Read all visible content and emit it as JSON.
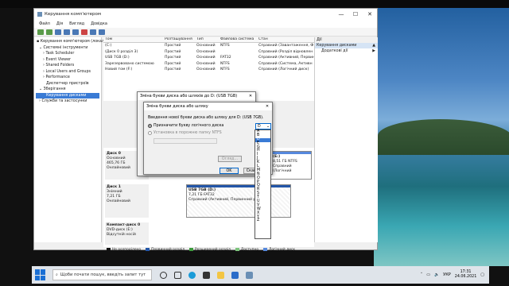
{
  "window": {
    "title": "Керування комп'ютером",
    "minimize": "—",
    "maximize": "☐",
    "close": "✕"
  },
  "menu": [
    "Файл",
    "Дія",
    "Вигляд",
    "Довідка"
  ],
  "tree": [
    {
      "label": "Керування комп'ютером (локальний)",
      "level": 0
    },
    {
      "label": "Системні інструменти",
      "level": 1
    },
    {
      "label": "Task Scheduler",
      "level": 2
    },
    {
      "label": "Event Viewer",
      "level": 2
    },
    {
      "label": "Shared Folders",
      "level": 2
    },
    {
      "label": "Local Users and Groups",
      "level": 2
    },
    {
      "label": "Performance",
      "level": 2
    },
    {
      "label": "Диспетчер пристроїв",
      "level": 2
    },
    {
      "label": "Зберігання",
      "level": 1
    },
    {
      "label": "Керування дисками",
      "level": 2,
      "selected": true
    },
    {
      "label": "Служби та застосунки",
      "level": 1
    }
  ],
  "grid": {
    "columns": [
      "Том",
      "Розташування",
      "Тип",
      "Файлова система",
      "Стан"
    ],
    "rows": [
      [
        "(C:)",
        "Простий",
        "Основний",
        "NTFS",
        "Справний (Завантаження, Ф"
      ],
      [
        "(Диск 0 розділ 3)",
        "Простий",
        "Основний",
        "",
        "Справний (Розділ відновлен"
      ],
      [
        "USB 7GB (D:)",
        "Простий",
        "Основний",
        "FAT32",
        "Справний (Активний, Первин"
      ],
      [
        "Зарезервовано системою",
        "Простий",
        "Основний",
        "NTFS",
        "Справний (Система, Активн"
      ],
      [
        "Новий том (F:)",
        "Простий",
        "Основний",
        "NTFS",
        "Справний (Логічний диск)"
      ]
    ]
  },
  "actions": {
    "header": "Дії",
    "section": "Керування дисками",
    "section_arrow": "▲",
    "more": "Додаткові дії",
    "more_arrow": "▶"
  },
  "disks": [
    {
      "name": "Диск 0",
      "type": "Основний",
      "size": "465,76 ГБ",
      "status": "Онлайновий"
    },
    {
      "name": "Диск 1",
      "type": "Знімний",
      "size": "7,21 ГБ",
      "status": "Онлайновий"
    },
    {
      "name": "Компакт-диск 0",
      "type": "DVD-диск (E:)",
      "size": "",
      "status": "Відсутній носій"
    }
  ],
  "partitions": {
    "d0_right_title": "(E:)",
    "d0_right_fs": "8,51 ГБ NTFS",
    "d0_right_status": "Справний (Логічний",
    "usb_title": "USB 7GB (D:)",
    "usb_fs": "7,21 ГБ FAT32",
    "usb_status": "Справний (Активний, Первинний розділ)"
  },
  "legend": [
    {
      "label": "Не розподілено",
      "color": "#111111"
    },
    {
      "label": "Первинний розділ",
      "color": "#2356a8"
    },
    {
      "label": "Розширений розділ",
      "color": "#3d9a3d"
    },
    {
      "label": "Доступно",
      "color": "#7cc47c"
    },
    {
      "label": "Логічний диск",
      "color": "#5588dd"
    }
  ],
  "dialog_back": {
    "title": "Зміна букви диска або шляхів до D: (USB 7GB)",
    "ok": "OK",
    "cancel": "Скасувати"
  },
  "dialog": {
    "title": "Зміна букви диска або шляху",
    "close": "✕",
    "prompt": "Введення нової букви диска або шляху для D: (USB 7GB).",
    "option_assign": "Призначити букву логічного диска",
    "option_mount": "Установка в порожню папку NTFS",
    "selected_letter": "D",
    "browse": "Огляд...",
    "ok": "OK",
    "cancel": "Скасувати"
  },
  "letters": [
    "A",
    "B",
    "D",
    "E",
    "G",
    "H",
    "I",
    "J",
    "K",
    "L",
    "M",
    "N",
    "O",
    "P",
    "Q",
    "R",
    "S",
    "T",
    "U",
    "V",
    "W",
    "X",
    "Y",
    "Z"
  ],
  "taskbar": {
    "search_placeholder": "Щоби почати пошук, введіть запит тут",
    "time": "17:31",
    "date": "24.06.2021",
    "lang": "УКР"
  }
}
